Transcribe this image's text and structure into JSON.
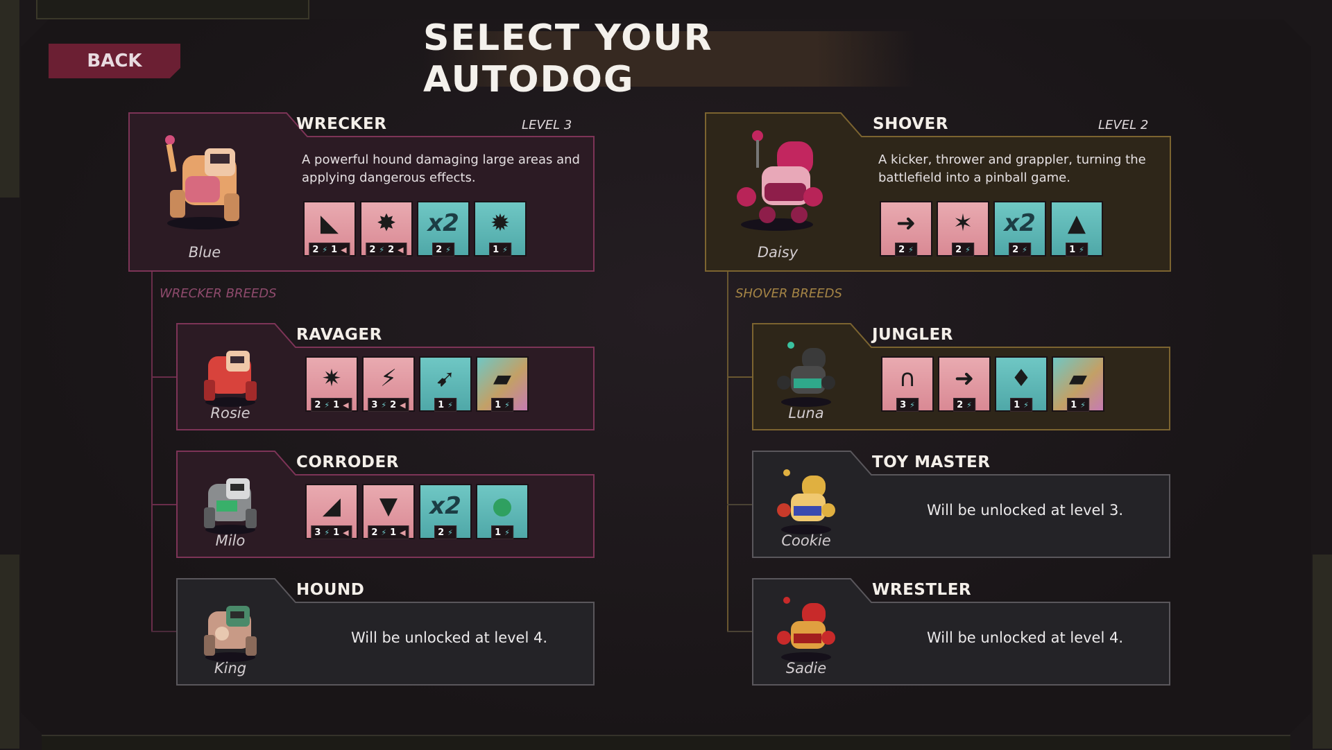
{
  "header": {
    "back_label": "BACK",
    "title": "SELECT YOUR AUTODOG"
  },
  "wrecker": {
    "class_name": "WRECKER",
    "level": "LEVEL 3",
    "description_line1": "A powerful hound damaging large areas and",
    "description_line2": "applying dangerous effects.",
    "dog_name": "Blue",
    "skills": [
      {
        "icon": "jaws-smash-icon",
        "style": "red",
        "energy": "2",
        "ammo": "1"
      },
      {
        "icon": "jaws-burst-icon",
        "style": "red",
        "energy": "2",
        "ammo": "2"
      },
      {
        "icon": "double-x2-icon",
        "style": "teal",
        "energy": "2",
        "ammo": ""
      },
      {
        "icon": "rocket-burst-icon",
        "style": "teal",
        "energy": "1",
        "ammo": ""
      }
    ],
    "breeds_label": "WRECKER BREEDS"
  },
  "ravager": {
    "class_name": "RAVAGER",
    "dog_name": "Rosie",
    "skills": [
      {
        "icon": "jaws-spark-icon",
        "style": "red",
        "energy": "2",
        "ammo": "1"
      },
      {
        "icon": "jaws-slash-icon",
        "style": "red",
        "energy": "3",
        "ammo": "2"
      },
      {
        "icon": "dog-dash-icon",
        "style": "teal",
        "energy": "1",
        "ammo": ""
      },
      {
        "icon": "dog-pad-icon",
        "style": "teal-rainbow",
        "energy": "1",
        "ammo": ""
      }
    ]
  },
  "corroder": {
    "class_name": "CORRODER",
    "dog_name": "Milo",
    "skills": [
      {
        "icon": "jaws-acid-icon",
        "style": "red",
        "energy": "3",
        "ammo": "1"
      },
      {
        "icon": "jaws-drip-icon",
        "style": "red",
        "energy": "2",
        "ammo": "1"
      },
      {
        "icon": "double-x2-icon",
        "style": "teal",
        "energy": "2",
        "ammo": ""
      },
      {
        "icon": "acid-drop-icon",
        "style": "teal",
        "energy": "1",
        "ammo": ""
      }
    ]
  },
  "hound": {
    "class_name": "HOUND",
    "dog_name": "King",
    "locked_text": "Will be unlocked at level 4."
  },
  "shover": {
    "class_name": "SHOVER",
    "level": "LEVEL 2",
    "description_line1": "A kicker, thrower and grappler, turning the",
    "description_line2": "battlefield into a pinball game.",
    "dog_name": "Daisy",
    "skills": [
      {
        "icon": "shove-arrow-icon",
        "style": "red",
        "energy": "2",
        "ammo": ""
      },
      {
        "icon": "dog-impact-icon",
        "style": "red",
        "energy": "2",
        "ammo": ""
      },
      {
        "icon": "double-x2-icon",
        "style": "teal",
        "energy": "2",
        "ammo": ""
      },
      {
        "icon": "crate-launch-icon",
        "style": "teal",
        "energy": "1",
        "ammo": ""
      }
    ],
    "breeds_label": "SHOVER BREEDS"
  },
  "jungler": {
    "class_name": "JUNGLER",
    "dog_name": "Luna",
    "skills": [
      {
        "icon": "magnet-pull-icon",
        "style": "red",
        "energy": "3",
        "ammo": ""
      },
      {
        "icon": "shove-arrow-icon",
        "style": "red",
        "energy": "2",
        "ammo": ""
      },
      {
        "icon": "spike-drop-icon",
        "style": "teal",
        "energy": "1",
        "ammo": ""
      },
      {
        "icon": "dog-pad-icon",
        "style": "teal-rainbow",
        "energy": "1",
        "ammo": ""
      }
    ]
  },
  "toymaster": {
    "class_name": "TOY MASTER",
    "dog_name": "Cookie",
    "locked_text": "Will be unlocked at level 3."
  },
  "wrestler": {
    "class_name": "WRESTLER",
    "dog_name": "Sadie",
    "locked_text": "Will be unlocked at level 4."
  },
  "colors": {
    "wrecker_accent": "#7d3457",
    "shover_accent": "#7c6430",
    "locked_accent": "#5a575c",
    "back_button": "#6b1f33",
    "breeds_pink": "#8e4a6c",
    "breeds_gold": "#a48445"
  }
}
